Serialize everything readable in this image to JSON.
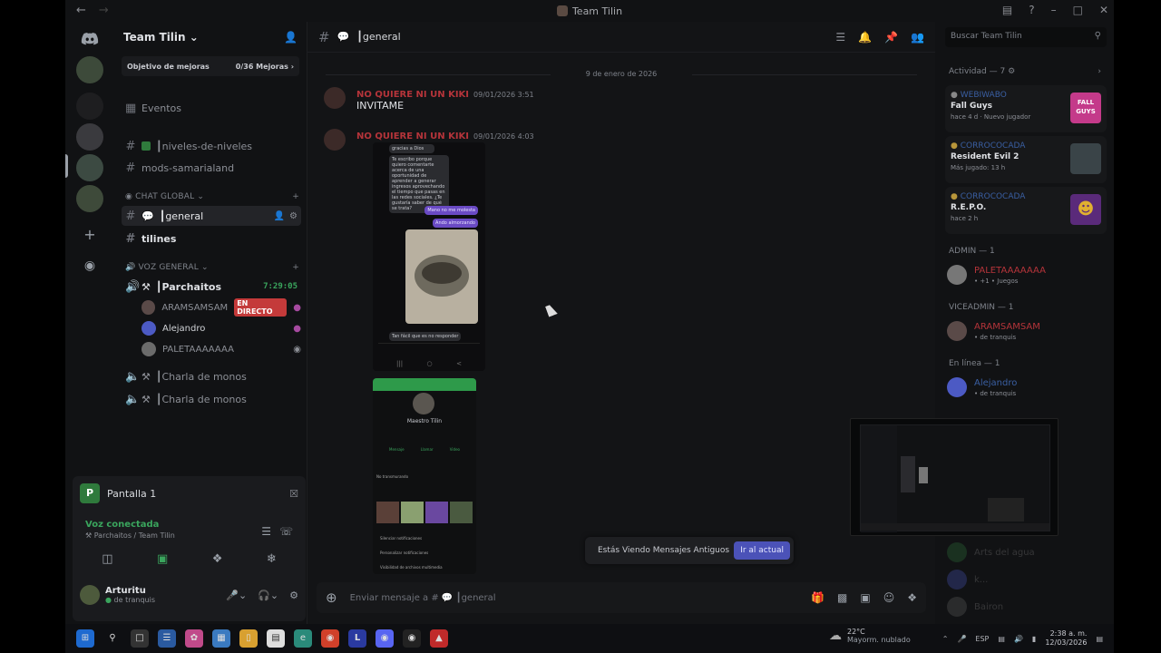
{
  "window": {
    "title": "Team Tilin"
  },
  "server": {
    "name": "Team Tilin",
    "boost_label": "Objetivo de mejoras",
    "boost_progress": "0/36 Mejoras"
  },
  "sidebar": {
    "events_label": "Eventos",
    "channels_top": [
      {
        "label": "┃niveles-de-niveles"
      },
      {
        "label": "mods-samarialand"
      }
    ],
    "chat_category": "CHAT GLOBAL",
    "chat_channels": [
      {
        "label": "┃general"
      },
      {
        "label": "tilines"
      }
    ],
    "voice_category": "VOZ GENERAL",
    "voice_channel_1": {
      "label": "┃Parchaitos",
      "time": "7:29:05"
    },
    "voice_users": [
      {
        "name": "ARAMSAMSAM",
        "badge": "EN DIRECTO"
      },
      {
        "name": "Alejandro"
      },
      {
        "name": "PALETAAAAAAA"
      }
    ],
    "voice_channel_2": {
      "label": "┃Charla de monos"
    },
    "voice_channel_3": {
      "label": "┃Charla de monos"
    }
  },
  "panel": {
    "screen_label": "Pantalla 1",
    "screen_initial": "P",
    "voice_status": "Voz conectada",
    "voice_location": "Parchaitos / Team Tilin",
    "user_name": "Arturitu",
    "user_status": "de tranquis"
  },
  "chat": {
    "channel": "┃general",
    "date_separator": "9 de enero de 2026",
    "messages": [
      {
        "author": "NO QUIERE NI UN KIKI",
        "time": "09/01/2026 3:51",
        "text": "INVITAME"
      },
      {
        "author": "NO QUIERE NI UN KIKI",
        "time": "09/01/2026 4:03",
        "text": ""
      }
    ],
    "screenshot_bubbles": [
      "gracias a Dios",
      "Te escribo porque quiero comentarte acerca de una oportunidad de aprender a generar ingresos aprovechando el tiempo que pasas en las redes sociales. ¿Te gustaría saber de qué se trata?",
      "Mano no me molesta",
      "Ando almorzando",
      "Tan fácil que es no responder"
    ],
    "contact_card": {
      "name": "Maestro Tilin",
      "actions": [
        "Mensaje",
        "Llamar",
        "Video"
      ],
      "notes": "No transmurando",
      "items": [
        "Silenciar notificaciones",
        "Personalizar notificaciones",
        "Visibilidad de archivos multimedia"
      ]
    },
    "old_messages_notice": "Estás Viendo Mensajes Antiguos",
    "jump_button": "Ir al actual",
    "composer_placeholder": "Enviar mensaje a #",
    "composer_channel": "┃general"
  },
  "members": {
    "search_placeholder": "Buscar Team Tilin",
    "activity_header": "Actividad — 7",
    "activities": [
      {
        "user": "WEBIWABO",
        "game": "Fall Guys",
        "meta": "hace 4 d · Nuevo jugador",
        "art_label": "FALL GUYS"
      },
      {
        "user": "CORROCOCADA",
        "game": "Resident Evil 2",
        "meta": "Más jugado: 13 h",
        "art_label": ""
      },
      {
        "user": "CORROCOCADA",
        "game": "R.E.P.O.",
        "meta": "hace 2 h",
        "art_label": ""
      }
    ],
    "groups": [
      {
        "title": "ADMIN — 1",
        "name": "PALETAAAAAAA",
        "status": "• +1 • Juegos",
        "color": "#b5343a"
      },
      {
        "title": "VICEADMIN — 1",
        "name": "ARAMSAMSAM",
        "status": "• de tranquis",
        "color": "#b5343a"
      },
      {
        "title": "En línea — 1",
        "name": "Alejandro",
        "status": "• de tranquis",
        "color": "#3a5fa3"
      }
    ],
    "offline": [
      "Arts del agua",
      "k...",
      "Bairon"
    ]
  },
  "taskbar": {
    "weather_temp": "22°C",
    "weather_desc": "Mayorm. nublado",
    "lang": "ESP",
    "time": "2:38 a. m.",
    "date": "12/03/2026"
  }
}
